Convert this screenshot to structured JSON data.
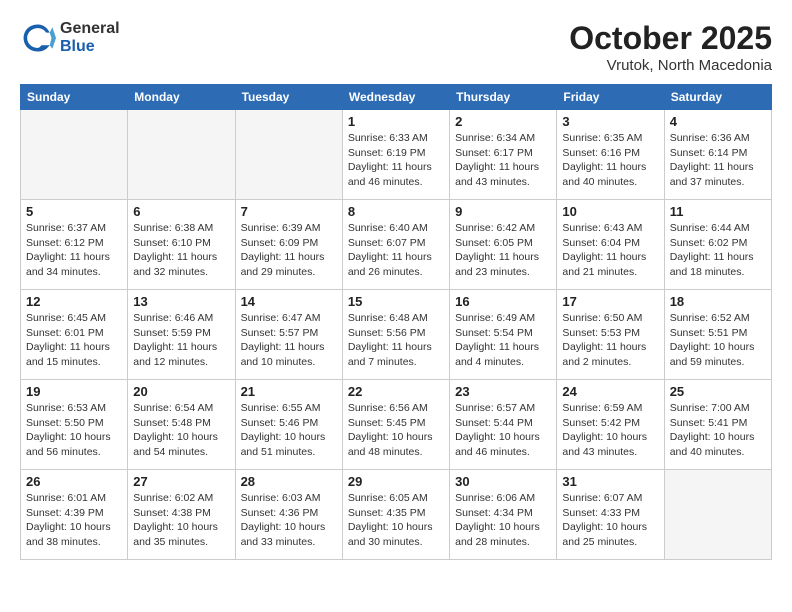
{
  "header": {
    "logo_general": "General",
    "logo_blue": "Blue",
    "month_title": "October 2025",
    "location": "Vrutok, North Macedonia"
  },
  "weekdays": [
    "Sunday",
    "Monday",
    "Tuesday",
    "Wednesday",
    "Thursday",
    "Friday",
    "Saturday"
  ],
  "weeks": [
    [
      {
        "day": "",
        "info": ""
      },
      {
        "day": "",
        "info": ""
      },
      {
        "day": "",
        "info": ""
      },
      {
        "day": "1",
        "info": "Sunrise: 6:33 AM\nSunset: 6:19 PM\nDaylight: 11 hours\nand 46 minutes."
      },
      {
        "day": "2",
        "info": "Sunrise: 6:34 AM\nSunset: 6:17 PM\nDaylight: 11 hours\nand 43 minutes."
      },
      {
        "day": "3",
        "info": "Sunrise: 6:35 AM\nSunset: 6:16 PM\nDaylight: 11 hours\nand 40 minutes."
      },
      {
        "day": "4",
        "info": "Sunrise: 6:36 AM\nSunset: 6:14 PM\nDaylight: 11 hours\nand 37 minutes."
      }
    ],
    [
      {
        "day": "5",
        "info": "Sunrise: 6:37 AM\nSunset: 6:12 PM\nDaylight: 11 hours\nand 34 minutes."
      },
      {
        "day": "6",
        "info": "Sunrise: 6:38 AM\nSunset: 6:10 PM\nDaylight: 11 hours\nand 32 minutes."
      },
      {
        "day": "7",
        "info": "Sunrise: 6:39 AM\nSunset: 6:09 PM\nDaylight: 11 hours\nand 29 minutes."
      },
      {
        "day": "8",
        "info": "Sunrise: 6:40 AM\nSunset: 6:07 PM\nDaylight: 11 hours\nand 26 minutes."
      },
      {
        "day": "9",
        "info": "Sunrise: 6:42 AM\nSunset: 6:05 PM\nDaylight: 11 hours\nand 23 minutes."
      },
      {
        "day": "10",
        "info": "Sunrise: 6:43 AM\nSunset: 6:04 PM\nDaylight: 11 hours\nand 21 minutes."
      },
      {
        "day": "11",
        "info": "Sunrise: 6:44 AM\nSunset: 6:02 PM\nDaylight: 11 hours\nand 18 minutes."
      }
    ],
    [
      {
        "day": "12",
        "info": "Sunrise: 6:45 AM\nSunset: 6:01 PM\nDaylight: 11 hours\nand 15 minutes."
      },
      {
        "day": "13",
        "info": "Sunrise: 6:46 AM\nSunset: 5:59 PM\nDaylight: 11 hours\nand 12 minutes."
      },
      {
        "day": "14",
        "info": "Sunrise: 6:47 AM\nSunset: 5:57 PM\nDaylight: 11 hours\nand 10 minutes."
      },
      {
        "day": "15",
        "info": "Sunrise: 6:48 AM\nSunset: 5:56 PM\nDaylight: 11 hours\nand 7 minutes."
      },
      {
        "day": "16",
        "info": "Sunrise: 6:49 AM\nSunset: 5:54 PM\nDaylight: 11 hours\nand 4 minutes."
      },
      {
        "day": "17",
        "info": "Sunrise: 6:50 AM\nSunset: 5:53 PM\nDaylight: 11 hours\nand 2 minutes."
      },
      {
        "day": "18",
        "info": "Sunrise: 6:52 AM\nSunset: 5:51 PM\nDaylight: 10 hours\nand 59 minutes."
      }
    ],
    [
      {
        "day": "19",
        "info": "Sunrise: 6:53 AM\nSunset: 5:50 PM\nDaylight: 10 hours\nand 56 minutes."
      },
      {
        "day": "20",
        "info": "Sunrise: 6:54 AM\nSunset: 5:48 PM\nDaylight: 10 hours\nand 54 minutes."
      },
      {
        "day": "21",
        "info": "Sunrise: 6:55 AM\nSunset: 5:46 PM\nDaylight: 10 hours\nand 51 minutes."
      },
      {
        "day": "22",
        "info": "Sunrise: 6:56 AM\nSunset: 5:45 PM\nDaylight: 10 hours\nand 48 minutes."
      },
      {
        "day": "23",
        "info": "Sunrise: 6:57 AM\nSunset: 5:44 PM\nDaylight: 10 hours\nand 46 minutes."
      },
      {
        "day": "24",
        "info": "Sunrise: 6:59 AM\nSunset: 5:42 PM\nDaylight: 10 hours\nand 43 minutes."
      },
      {
        "day": "25",
        "info": "Sunrise: 7:00 AM\nSunset: 5:41 PM\nDaylight: 10 hours\nand 40 minutes."
      }
    ],
    [
      {
        "day": "26",
        "info": "Sunrise: 6:01 AM\nSunset: 4:39 PM\nDaylight: 10 hours\nand 38 minutes."
      },
      {
        "day": "27",
        "info": "Sunrise: 6:02 AM\nSunset: 4:38 PM\nDaylight: 10 hours\nand 35 minutes."
      },
      {
        "day": "28",
        "info": "Sunrise: 6:03 AM\nSunset: 4:36 PM\nDaylight: 10 hours\nand 33 minutes."
      },
      {
        "day": "29",
        "info": "Sunrise: 6:05 AM\nSunset: 4:35 PM\nDaylight: 10 hours\nand 30 minutes."
      },
      {
        "day": "30",
        "info": "Sunrise: 6:06 AM\nSunset: 4:34 PM\nDaylight: 10 hours\nand 28 minutes."
      },
      {
        "day": "31",
        "info": "Sunrise: 6:07 AM\nSunset: 4:33 PM\nDaylight: 10 hours\nand 25 minutes."
      },
      {
        "day": "",
        "info": ""
      }
    ]
  ]
}
